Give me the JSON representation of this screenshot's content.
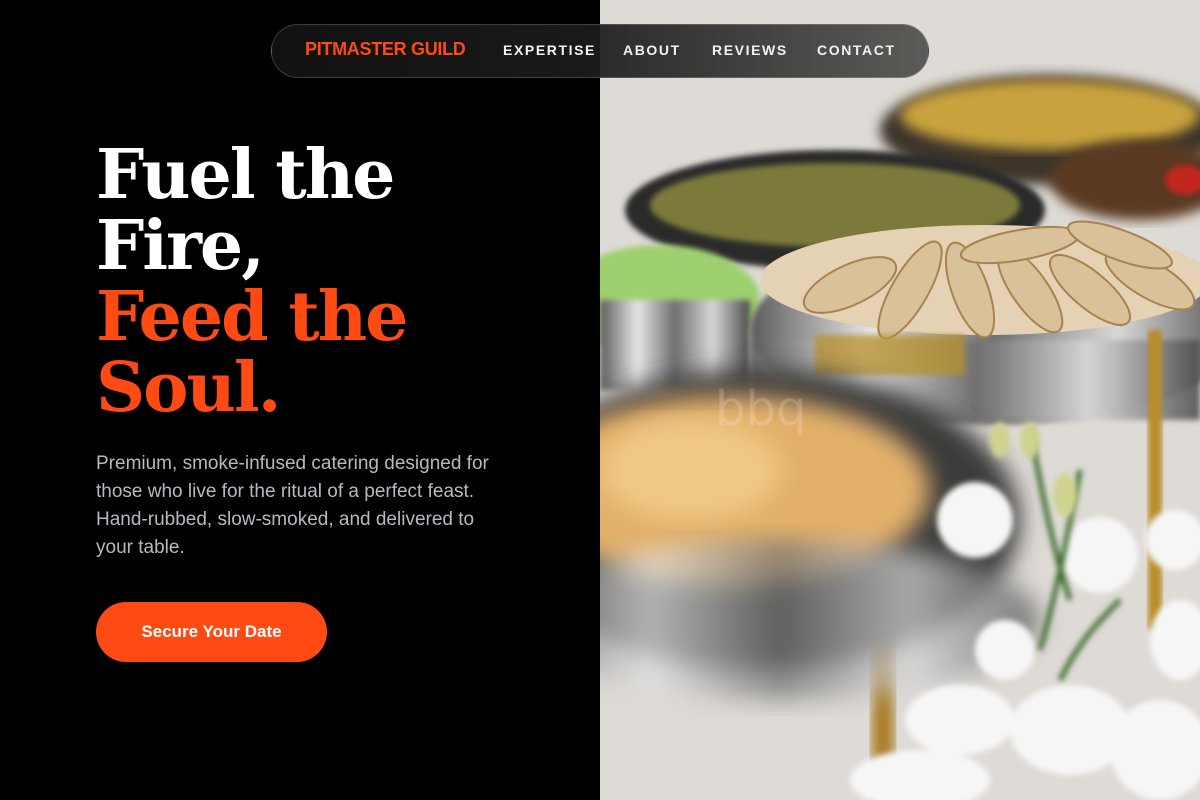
{
  "nav": {
    "brand": "PITMASTER GUILD",
    "links": [
      "EXPERTISE",
      "ABOUT",
      "REVIEWS",
      "CONTACT"
    ]
  },
  "hero": {
    "headline_white": [
      "Fuel the",
      "Fire,"
    ],
    "headline_orange": [
      "Feed the",
      "Soul."
    ],
    "description": "Premium, smoke-infused catering designed for those who live for the ritual of a perfect feast. Hand-rubbed, slow-smoked, and delivered to your table.",
    "cta_label": "Secure Your Date"
  },
  "image": {
    "subject": "catering buffet chafing dishes with food and white flowers",
    "watermark": "bbq"
  },
  "colors": {
    "accent": "#ff4a14",
    "background": "#000000",
    "text_primary": "#ffffff",
    "text_muted": "#b8b8c0"
  }
}
